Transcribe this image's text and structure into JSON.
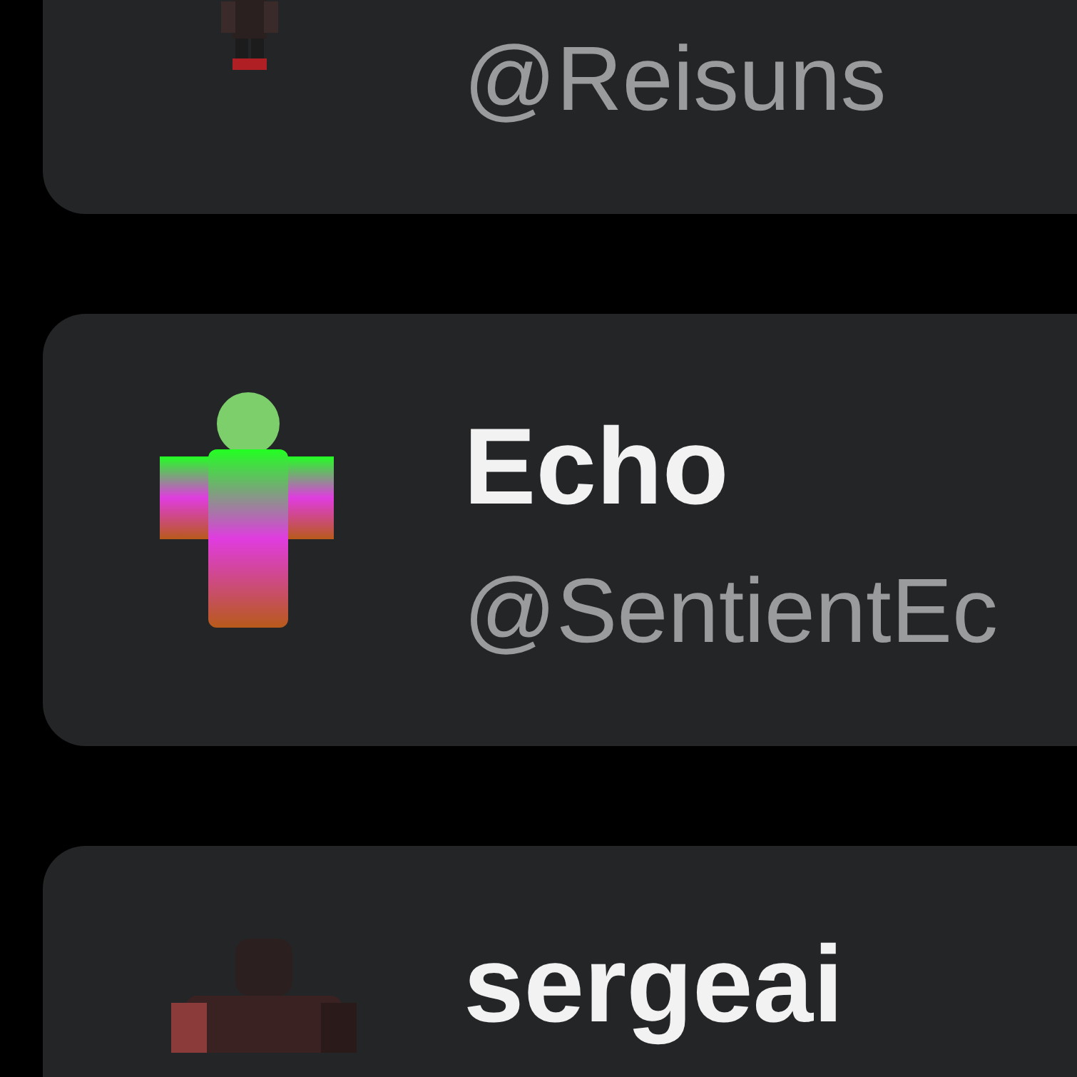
{
  "friends": [
    {
      "handle": "@Reisuns"
    },
    {
      "name": "Echo",
      "handle": "@SentientEc"
    },
    {
      "name": "sergeai"
    }
  ]
}
